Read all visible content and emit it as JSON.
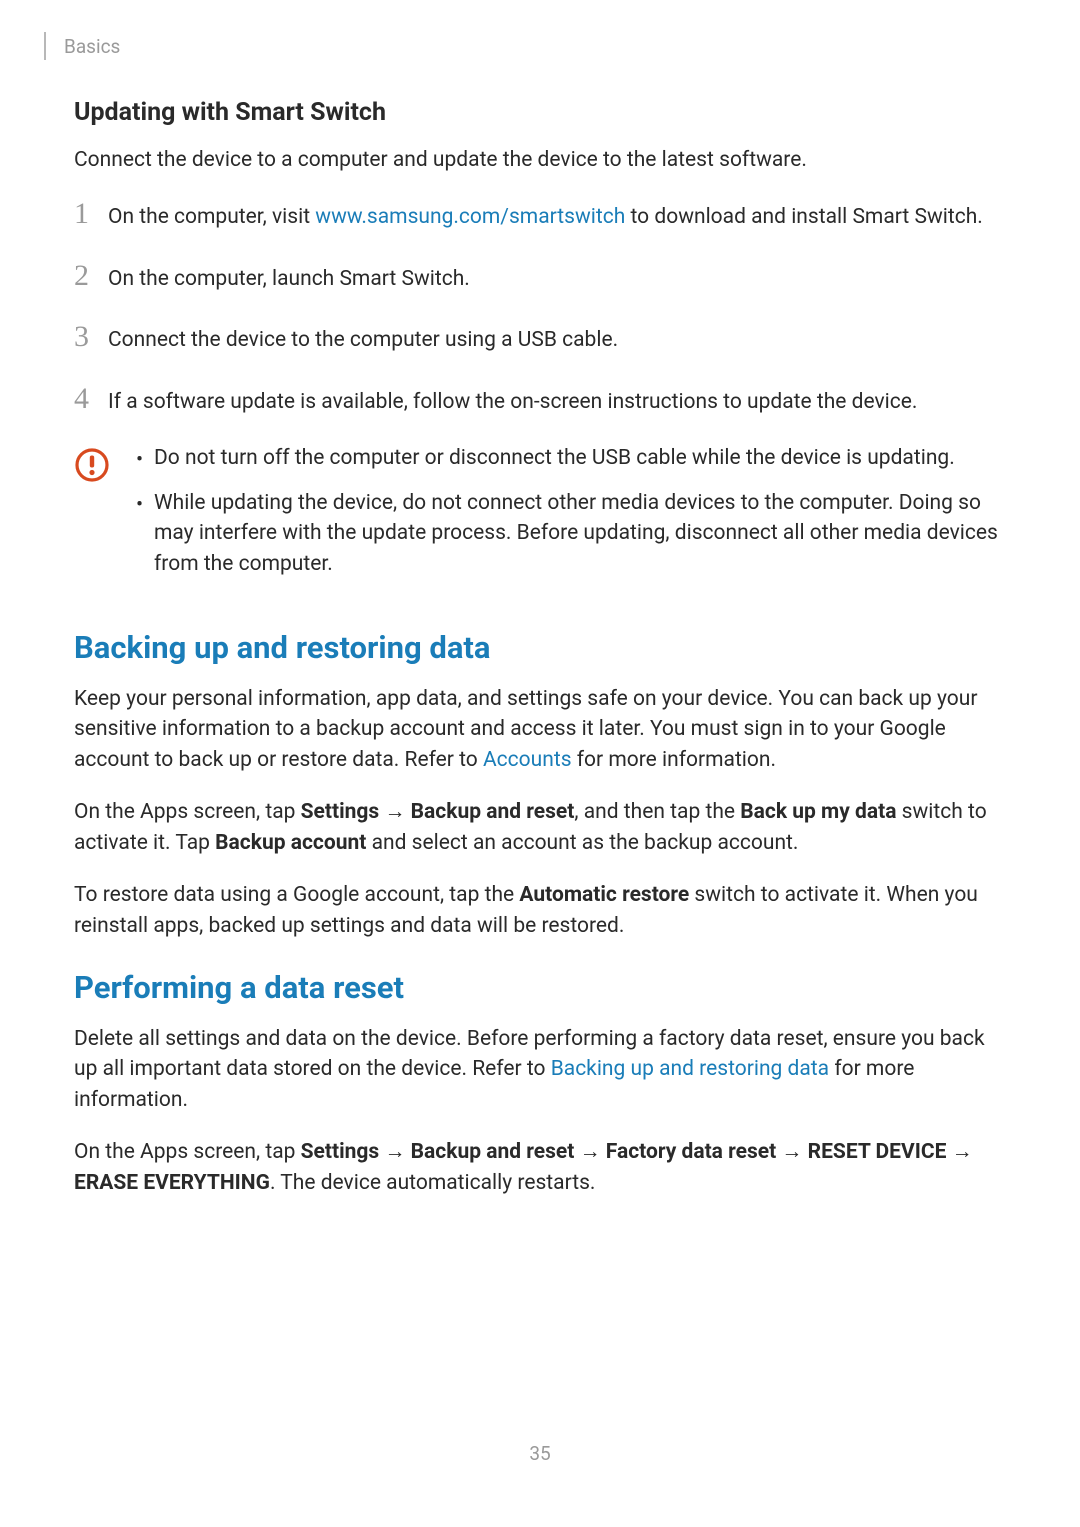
{
  "header": {
    "breadcrumb": "Basics"
  },
  "section1": {
    "heading": "Updating with Smart Switch",
    "intro": "Connect the device to a computer and update the device to the latest software.",
    "steps": [
      {
        "num": "1",
        "pre": "On the computer, visit ",
        "link": "www.samsung.com/smartswitch",
        "post": " to download and install Smart Switch."
      },
      {
        "num": "2",
        "text": "On the computer, launch Smart Switch."
      },
      {
        "num": "3",
        "text": "Connect the device to the computer using a USB cable."
      },
      {
        "num": "4",
        "text": "If a software update is available, follow the on-screen instructions to update the device."
      }
    ],
    "cautions": [
      "Do not turn off the computer or disconnect the USB cable while the device is updating.",
      "While updating the device, do not connect other media devices to the computer. Doing so may interfere with the update process. Before updating, disconnect all other media devices from the computer."
    ]
  },
  "section2": {
    "heading": "Backing up and restoring data",
    "p1_pre": "Keep your personal information, app data, and settings safe on your device. You can back up your sensitive information to a backup account and access it later. You must sign in to your Google account to back up or restore data. Refer to ",
    "p1_link": "Accounts",
    "p1_post": " for more information.",
    "p2_a": "On the Apps screen, tap ",
    "p2_b": "Settings",
    "p2_c": "Backup and reset",
    "p2_d": ", and then tap the ",
    "p2_e": "Back up my data",
    "p2_f": " switch to activate it. Tap ",
    "p2_g": "Backup account",
    "p2_h": " and select an account as the backup account.",
    "p3_a": "To restore data using a Google account, tap the ",
    "p3_b": "Automatic restore",
    "p3_c": " switch to activate it. When you reinstall apps, backed up settings and data will be restored."
  },
  "section3": {
    "heading": "Performing a data reset",
    "p1_pre": "Delete all settings and data on the device. Before performing a factory data reset, ensure you back up all important data stored on the device. Refer to ",
    "p1_link": "Backing up and restoring data",
    "p1_post": " for more information.",
    "p2_a": "On the Apps screen, tap ",
    "p2_b": "Settings",
    "p2_c": "Backup and reset",
    "p2_d": "Factory data reset",
    "p2_e": "RESET DEVICE",
    "p2_f": "ERASE EVERYTHING",
    "p2_g": ". The device automatically restarts."
  },
  "arrow": " → ",
  "bullet": "•",
  "page_number": "35"
}
